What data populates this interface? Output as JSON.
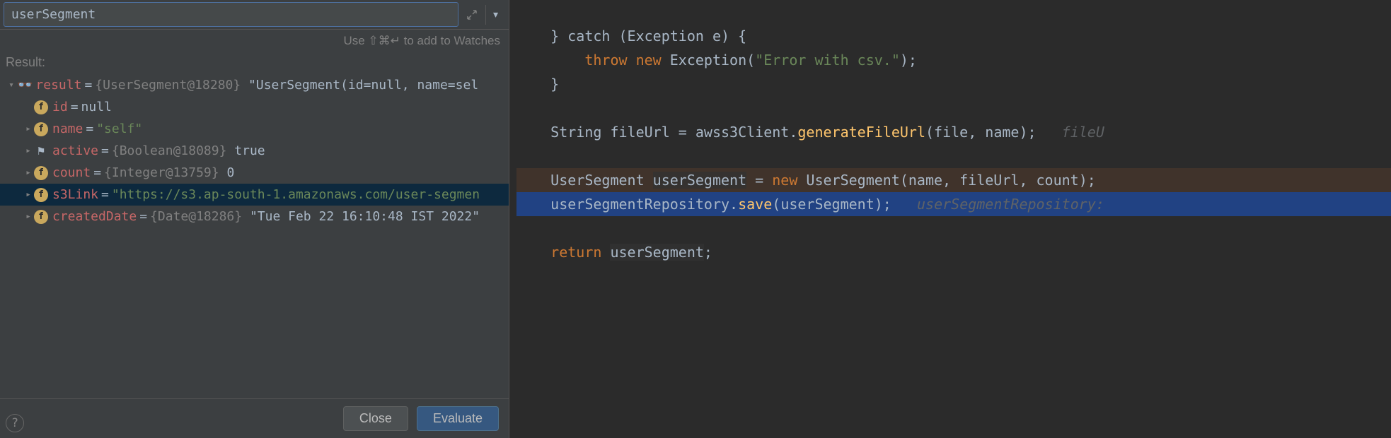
{
  "expression_input": "userSegment",
  "hint_text": "Use ⇧⌘↵ to add to Watches",
  "result_label": "Result:",
  "tree": {
    "root": {
      "name": "result",
      "type": "{UserSegment@18280}",
      "value": "\"UserSegment(id=null, name=sel"
    },
    "id_field": {
      "name": "id",
      "value": "null"
    },
    "name_field": {
      "name": "name",
      "value": "\"self\""
    },
    "active_field": {
      "name": "active",
      "type": "{Boolean@18089}",
      "value": "true"
    },
    "count_field": {
      "name": "count",
      "type": "{Integer@13759}",
      "value": "0"
    },
    "s3link_field": {
      "name": "s3Link",
      "value": "\"https://s3.ap-south-1.amazonaws.com/user-segmen"
    },
    "created_field": {
      "name": "createdDate",
      "type": "{Date@18286}",
      "value": "\"Tue Feb 22 16:10:48 IST 2022\""
    }
  },
  "buttons": {
    "close": "Close",
    "evaluate": "Evaluate"
  },
  "code": {
    "l1": "    } catch (Exception e) {",
    "l2_pre": "        ",
    "l2_throw": "throw",
    "l2_new": "new",
    "l2_ex": "Exception(",
    "l2_str": "\"Error with csv.\"",
    "l2_end": ");",
    "l3": "    }",
    "l5_pre": "    String fileUrl = ",
    "l5_client": "awss3Client",
    "l5_dot": ".",
    "l5_method": "generateFileUrl",
    "l5_args": "(file, name);",
    "l5_hint": "   fileU",
    "l7_pre": "    UserSegment ",
    "l7_var": "userSegment",
    "l7_eq": " = ",
    "l7_new": "new",
    "l7_rest": " UserSegment(name, fileUrl, count);",
    "l8_pre": "    ",
    "l8_repo": "userSegmentRepository",
    "l8_dot": ".",
    "l8_method": "save",
    "l8_open": "(",
    "l8_arg": "userSegment",
    "l8_close": ");",
    "l8_hint": "   userSegmentRepository:",
    "l10_pre": "    ",
    "l10_ret": "return",
    "l10_sp": " ",
    "l10_var": "userSegment",
    "l10_semi": ";"
  }
}
